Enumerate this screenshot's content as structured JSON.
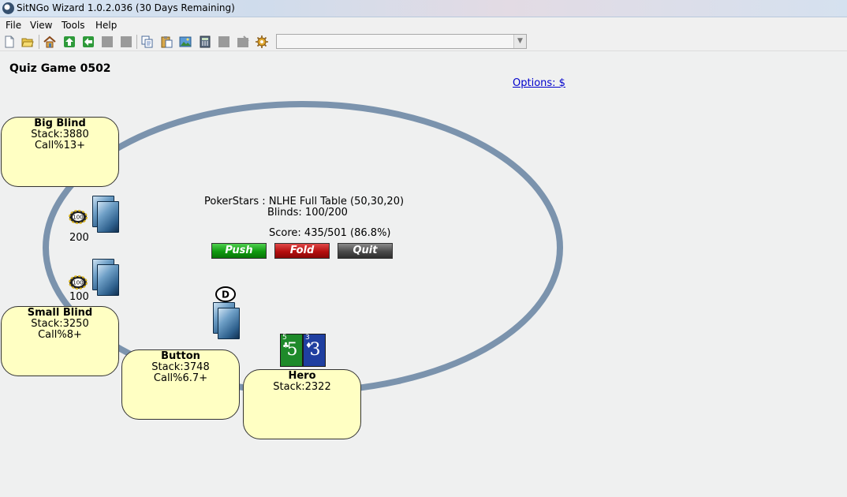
{
  "window": {
    "title": "SitNGo Wizard 1.0.2.036 (30 Days Remaining)",
    "app_icon": "sitngo-wizard-logo-icon"
  },
  "menu": [
    "File",
    "View",
    "Tools",
    "Help"
  ],
  "toolbar": {
    "icons": [
      "new-file-icon",
      "open-folder-icon",
      "home-icon",
      "up-arrow-icon",
      "back-arrow-icon",
      "disabled-icon",
      "disabled-icon",
      "copy-icon",
      "paste-icon",
      "image-icon",
      "calculator-icon",
      "disabled-icon",
      "disabled-icon",
      "settings-gear-icon"
    ],
    "combo_value": ""
  },
  "game": {
    "title": "Quiz Game 0502",
    "options_link": "Options: $"
  },
  "table": {
    "line1": "PokerStars : NLHE Full Table (50,30,20)",
    "line2": "Blinds: 100/200",
    "score": "Score: 435/501 (86.8%)",
    "felt_color": "#7b93ad"
  },
  "actions": {
    "push": "Push",
    "fold": "Fold",
    "quit": "Quit"
  },
  "seats": {
    "big_blind": {
      "position": "Big Blind",
      "stack": "Stack:3880",
      "call": "Call%13+",
      "bet": "200",
      "chip_label": "100"
    },
    "small_blind": {
      "position": "Small Blind",
      "stack": "Stack:3250",
      "call": "Call%8+",
      "bet": "100",
      "chip_label": "100"
    },
    "button": {
      "position": "Button",
      "stack": "Stack:3748",
      "call": "Call%6.7+",
      "dealer_label": "D"
    },
    "hero": {
      "position": "Hero",
      "stack": "Stack:2322"
    }
  },
  "hero_cards": [
    {
      "rank": "5",
      "suit": "♣",
      "color": "#1e8a2a"
    },
    {
      "rank": "3",
      "suit": "♦",
      "color": "#1f3fa0"
    }
  ]
}
